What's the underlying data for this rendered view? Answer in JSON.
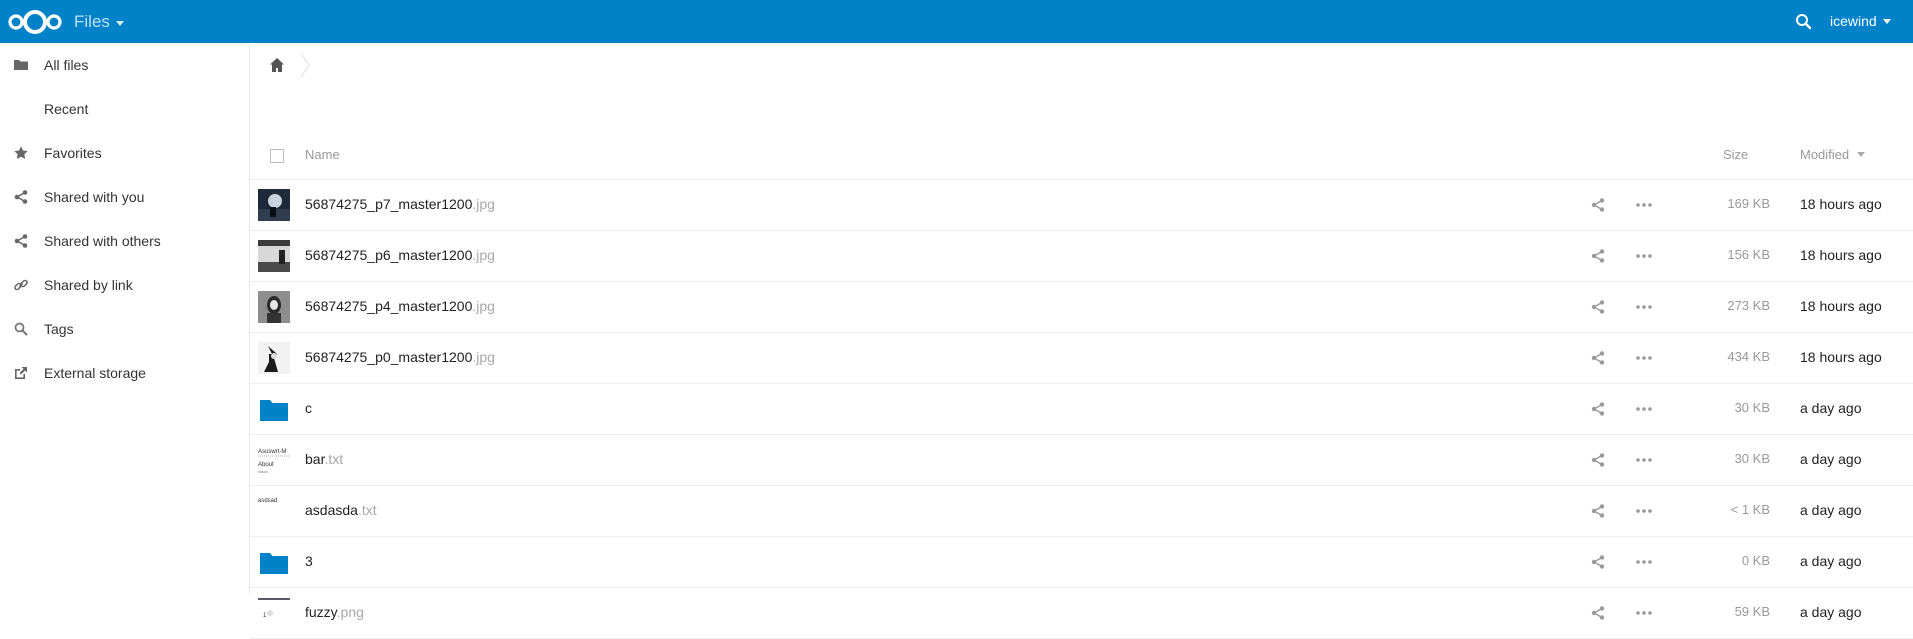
{
  "header": {
    "app_name": "Files",
    "user": "icewind",
    "brand_color": "#0082c9",
    "icons": [
      "nextcloud-logo",
      "search-icon"
    ]
  },
  "sidebar": {
    "items": [
      {
        "label": "All files",
        "icon": "folder-icon"
      },
      {
        "label": "Recent",
        "icon": "none"
      },
      {
        "label": "Favorites",
        "icon": "star-icon"
      },
      {
        "label": "Shared with you",
        "icon": "share-icon"
      },
      {
        "label": "Shared with others",
        "icon": "share-icon"
      },
      {
        "label": "Shared by link",
        "icon": "link-icon"
      },
      {
        "label": "Tags",
        "icon": "tag-search-icon"
      },
      {
        "label": "External storage",
        "icon": "external-link-icon"
      }
    ]
  },
  "table": {
    "columns": {
      "name": "Name",
      "size": "Size",
      "modified": "Modified"
    },
    "rows": [
      {
        "name": "56874275_p7_master1200",
        "ext": ".jpg",
        "size": "169 KB",
        "modified": "18 hours ago",
        "thumb": "image-dark-1"
      },
      {
        "name": "56874275_p6_master1200",
        "ext": ".jpg",
        "size": "156 KB",
        "modified": "18 hours ago",
        "thumb": "image-dark-2"
      },
      {
        "name": "56874275_p4_master1200",
        "ext": ".jpg",
        "size": "273 KB",
        "modified": "18 hours ago",
        "thumb": "image-grey"
      },
      {
        "name": "56874275_p0_master1200",
        "ext": ".jpg",
        "size": "434 KB",
        "modified": "18 hours ago",
        "thumb": "image-light"
      },
      {
        "name": "c",
        "ext": "",
        "size": "30 KB",
        "modified": "a day ago",
        "thumb": "folder"
      },
      {
        "name": "bar",
        "ext": ".txt",
        "size": "30 KB",
        "modified": "a day ago",
        "thumb": "text-bar",
        "preview_lines": [
          "Asuswrt-M",
          "About"
        ]
      },
      {
        "name": "asdasda",
        "ext": ".txt",
        "size": "< 1 KB",
        "modified": "a day ago",
        "thumb": "text-asd",
        "preview_lines": [
          "asdsad"
        ]
      },
      {
        "name": "3",
        "ext": "",
        "size": "0 KB",
        "modified": "a day ago",
        "thumb": "folder"
      },
      {
        "name": "fuzzy",
        "ext": ".png",
        "size": "59 KB",
        "modified": "a day ago",
        "thumb": "image-fuzzy",
        "preview_lines": [
          "1"
        ]
      }
    ]
  }
}
